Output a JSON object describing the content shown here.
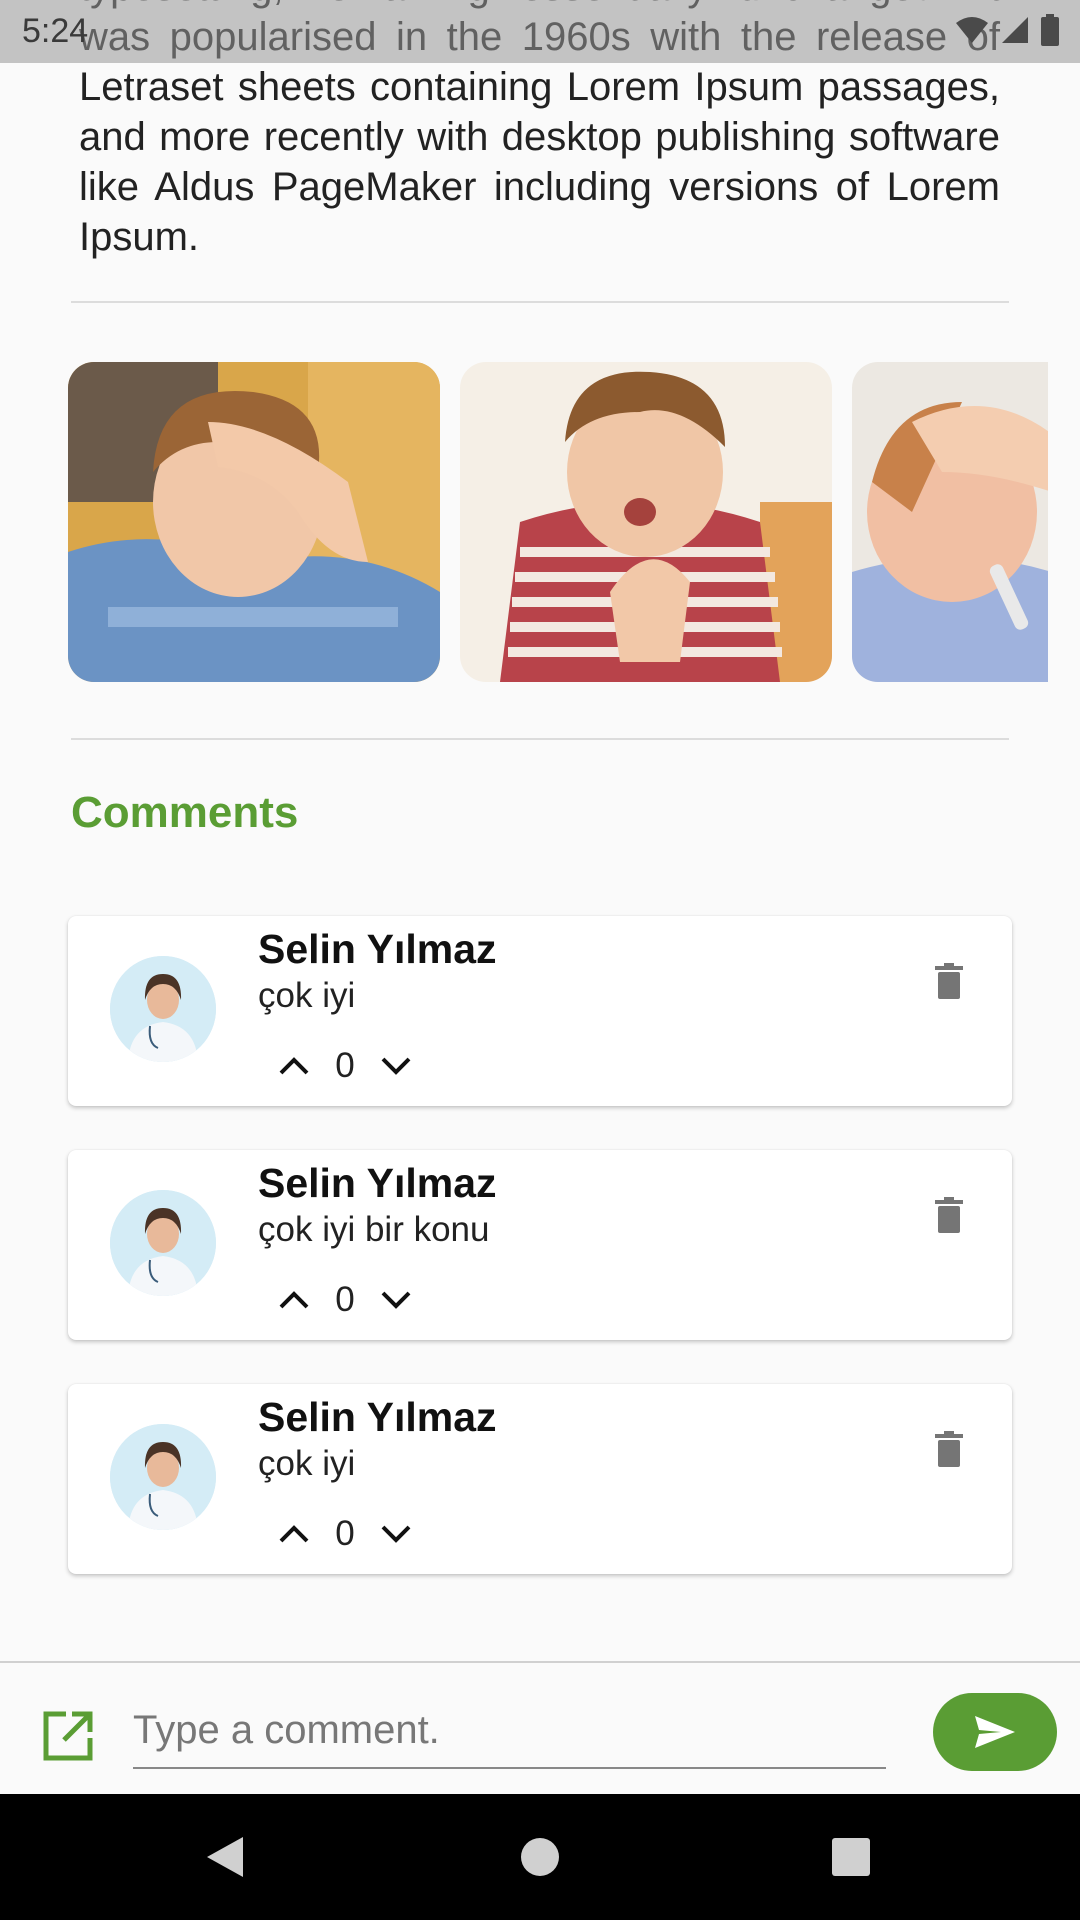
{
  "status_bar": {
    "time": "5:24"
  },
  "article": {
    "text": "typesetting, remaining essentially unchanged. It was popularised in the 1960s with the release of Letraset sheets containing Lorem Ipsum passages, and more recently with desktop publishing software like Aldus PageMaker including versions of Lorem Ipsum."
  },
  "gallery": {
    "images": [
      {
        "description": "child with hand on forehead"
      },
      {
        "description": "child coughing holding throat"
      },
      {
        "description": "child with thermometer in bed"
      }
    ]
  },
  "comments": {
    "title": "Comments",
    "items": [
      {
        "author": "Selin Yılmaz",
        "text": "çok iyi",
        "votes": "0"
      },
      {
        "author": "Selin Yılmaz",
        "text": "çok iyi bir konu",
        "votes": "0"
      },
      {
        "author": "Selin Yılmaz",
        "text": "çok iyi",
        "votes": "0"
      }
    ]
  },
  "comment_input": {
    "placeholder": "Type a comment."
  },
  "colors": {
    "accent": "#5a9d34",
    "icon_grey": "#757575",
    "navbar": "#000000"
  },
  "icons": {
    "upvote": "chevron-up-icon",
    "downvote": "chevron-down-icon",
    "delete": "trash-icon",
    "edit": "open-external-icon",
    "send": "send-icon"
  }
}
